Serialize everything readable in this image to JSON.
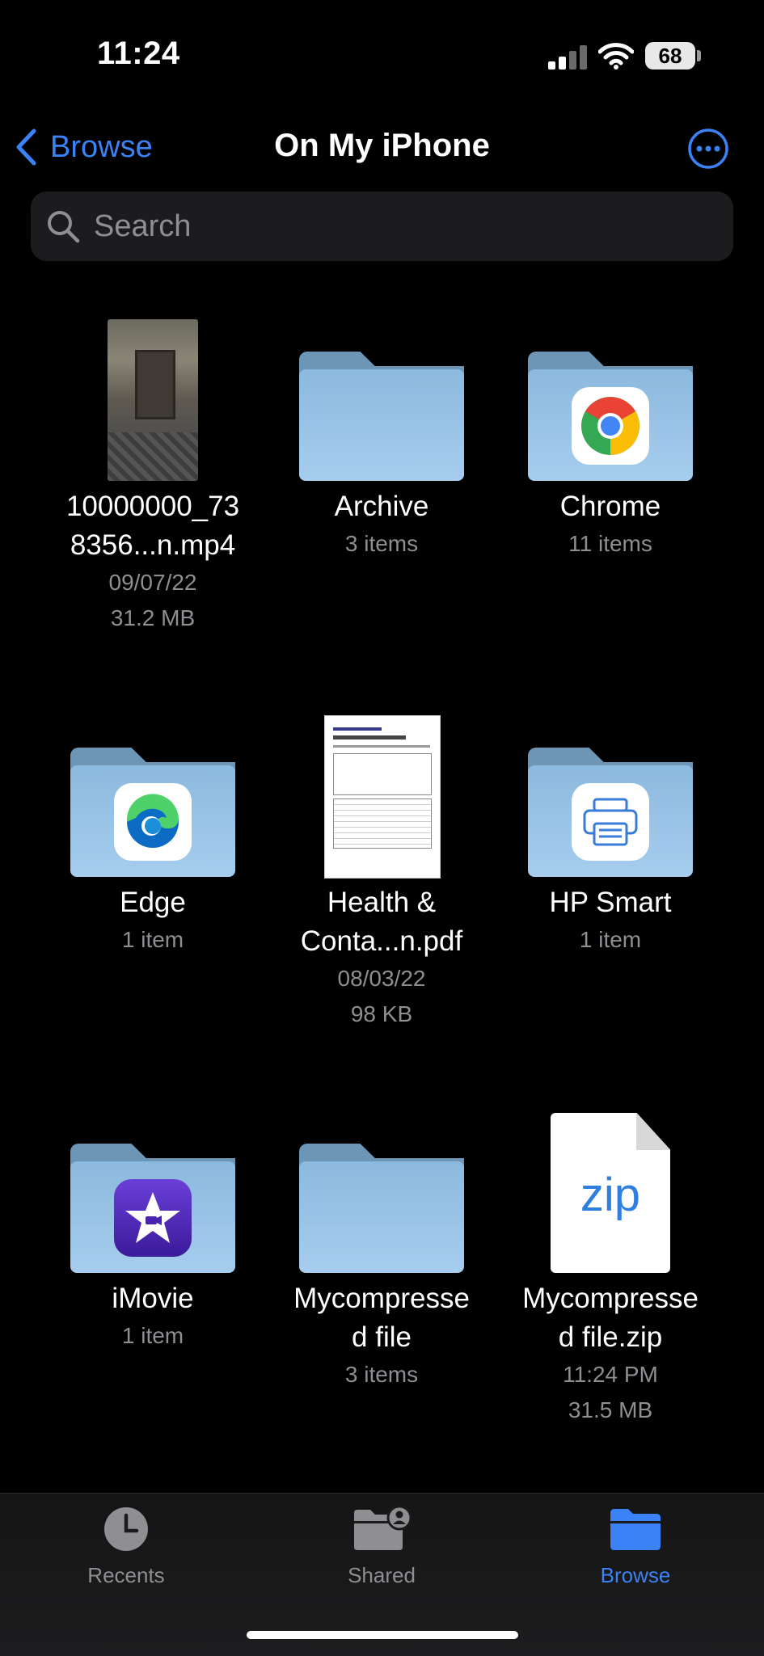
{
  "status_bar": {
    "time": "11:24",
    "battery": "68"
  },
  "nav": {
    "back_label": "Browse",
    "title": "On My iPhone"
  },
  "search": {
    "placeholder": "Search"
  },
  "items": [
    {
      "name": "10000000_73\n8356...n.mp4",
      "date": "09/07/22",
      "size": "31.2 MB"
    },
    {
      "name": "Archive",
      "count": "3 items"
    },
    {
      "name": "Chrome",
      "count": "11 items"
    },
    {
      "name": "Edge",
      "count": "1 item"
    },
    {
      "name": "Health &\nConta...n.pdf",
      "date": "08/03/22",
      "size": "98 KB"
    },
    {
      "name": "HP Smart",
      "count": "1 item"
    },
    {
      "name": "iMovie",
      "count": "1 item"
    },
    {
      "name": "Mycompresse\nd file",
      "count": "3 items"
    },
    {
      "name": "Mycompresse\nd file.zip",
      "date": "11:24 PM",
      "size": "31.5 MB",
      "badge": "zip"
    }
  ],
  "tabs": [
    {
      "label": "Recents",
      "icon": "clock-icon",
      "active": false
    },
    {
      "label": "Shared",
      "icon": "shared-folder-icon",
      "active": false
    },
    {
      "label": "Browse",
      "icon": "folder-icon",
      "active": true
    }
  ],
  "colors": {
    "accent": "#3b82f6",
    "folder": "#9cc4e6",
    "secondary_text": "#8e8e93"
  }
}
